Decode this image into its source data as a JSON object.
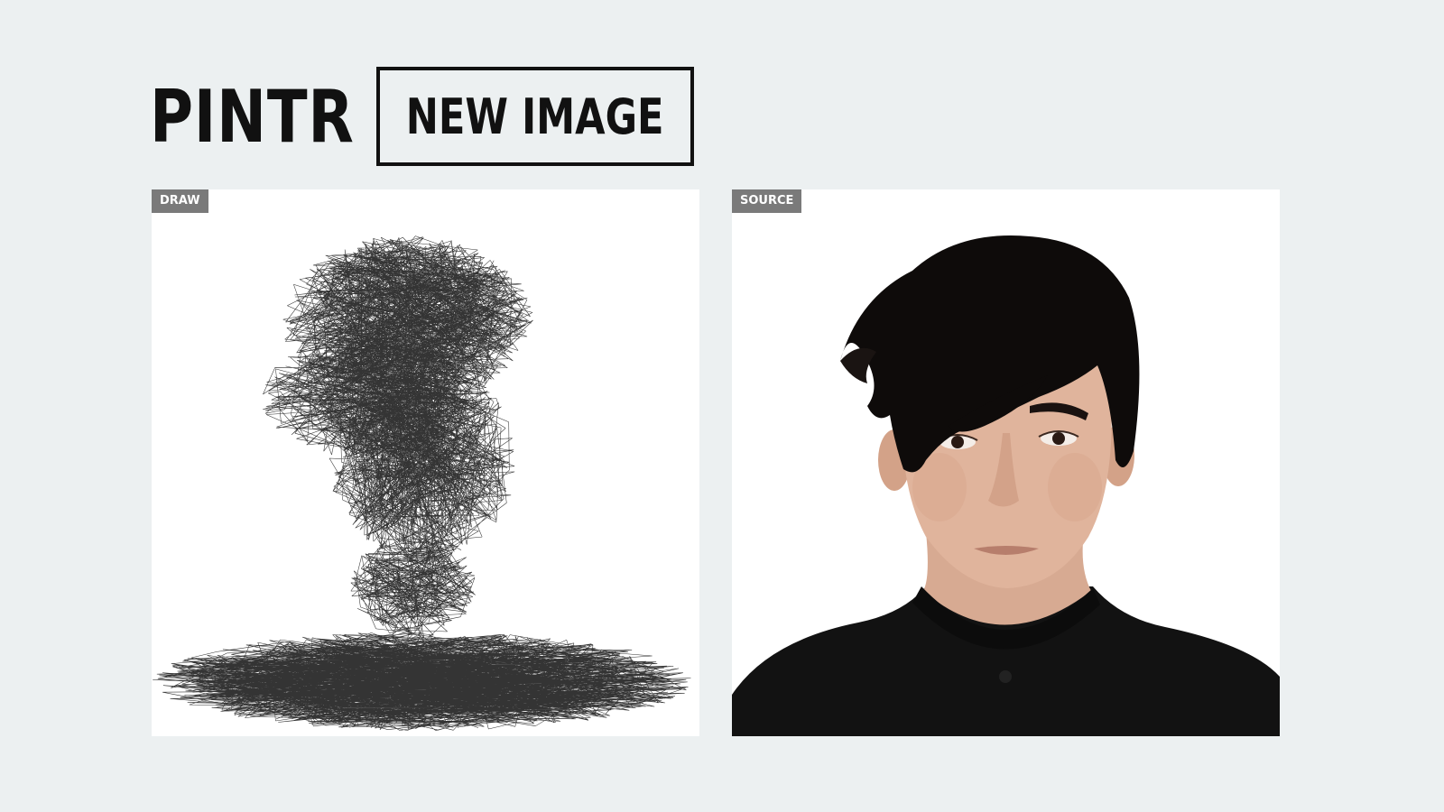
{
  "header": {
    "brand": "PINTR",
    "new_image_label": "NEW IMAGE"
  },
  "panels": {
    "draw": {
      "tag": "DRAW"
    },
    "source": {
      "tag": "SOURCE"
    }
  },
  "colors": {
    "background": "#ecf0f1",
    "panel": "#ffffff",
    "ink": "#111111",
    "tag": "#7a7a7a"
  }
}
